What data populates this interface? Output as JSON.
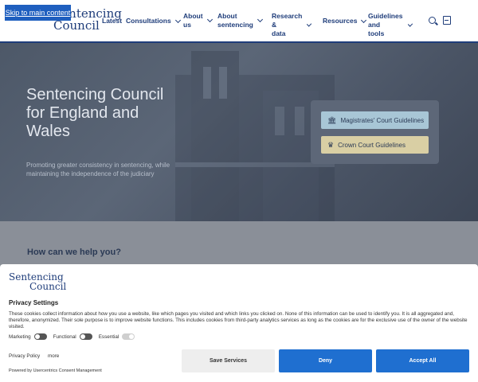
{
  "skip_link": "Skip to main content",
  "logo": {
    "line1": "Sentencing",
    "line2": "Council"
  },
  "nav": {
    "latest": "Latest",
    "consultations": "Consultations",
    "about_us": [
      "About",
      "us"
    ],
    "about_sentencing": [
      "About",
      "sentencing"
    ],
    "research": [
      "Research &",
      "data"
    ],
    "resources": "Resources",
    "guidelines": [
      "Guidelines and",
      "tools"
    ]
  },
  "hero": {
    "title": "Sentencing Council for England and Wales",
    "subtitle": "Promoting greater consistency in sentencing, while maintaining the independence of the judiciary",
    "magistrates_btn": "Magistrates' Court Guidelines",
    "crown_btn": "Crown Court Guidelines"
  },
  "help": {
    "title": "How can we help you?"
  },
  "cookie": {
    "logo": {
      "line1": "Sentencing",
      "line2": "Council"
    },
    "title": "Privacy Settings",
    "body": "These cookies collect information about how you use a website, like which pages you visited and which links you clicked on. None of this information can be used to identify you. It is all aggregated and, therefore, anonymized. Their sole purpose is to improve website functions. This includes cookies from third-party analytics services as long as the cookies are for the exclusive use of the owner of the website visited.",
    "toggles": {
      "marketing": "Marketing",
      "functional": "Functional",
      "essential": "Essential"
    },
    "links": {
      "privacy": "Privacy Policy",
      "more": "more"
    },
    "powered": "Powered by Usercentrics Consent Management",
    "buttons": {
      "save": "Save Services",
      "deny": "Deny",
      "accept": "Accept All"
    }
  },
  "colors": {
    "brand": "#1f3d7a",
    "accent": "#1f6fd0"
  }
}
